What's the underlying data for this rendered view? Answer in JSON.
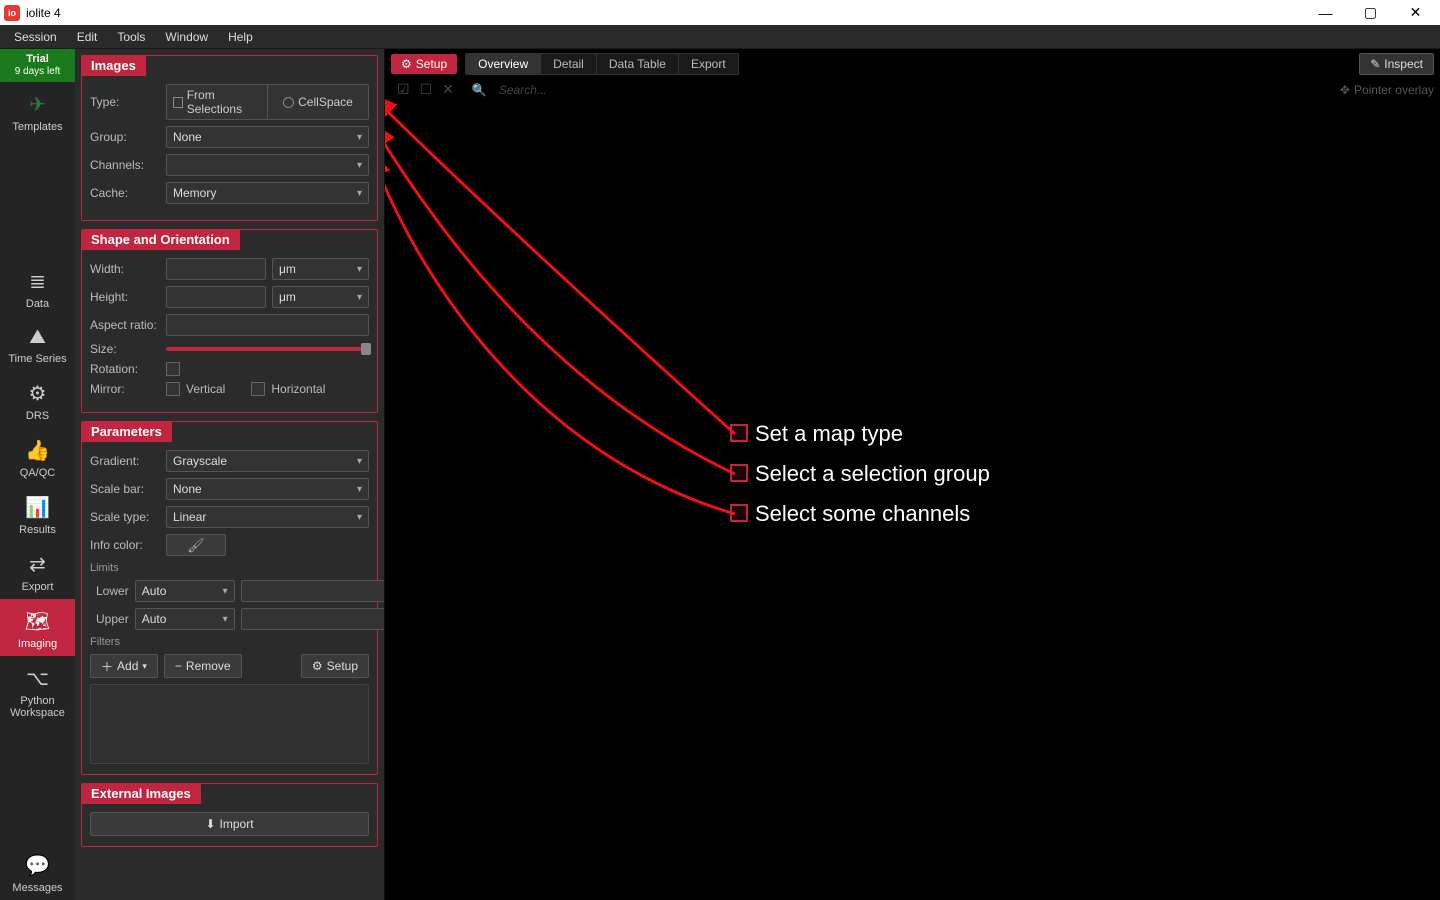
{
  "app": {
    "title": "iolite 4"
  },
  "window_controls": {
    "min": "—",
    "max": "▢",
    "close": "✕"
  },
  "menubar": [
    "Session",
    "Edit",
    "Tools",
    "Window",
    "Help"
  ],
  "trial": {
    "line1": "Trial",
    "line2": "9 days left"
  },
  "sidebar": [
    {
      "label": "Templates",
      "icon": "✈"
    },
    {
      "label": "Data",
      "icon": "≣"
    },
    {
      "label": "Time Series",
      "icon": "⛰"
    },
    {
      "label": "DRS",
      "icon": "⚙"
    },
    {
      "label": "QA/QC",
      "icon": "👍"
    },
    {
      "label": "Results",
      "icon": "📊"
    },
    {
      "label": "Export",
      "icon": "⇄"
    },
    {
      "label": "Imaging",
      "icon": "🗺"
    },
    {
      "label": "Python Workspace",
      "icon": "⌥"
    }
  ],
  "sidebar_bottom": {
    "label": "Messages",
    "icon": "💬"
  },
  "panel": {
    "images": {
      "header": "Images",
      "type_label": "Type:",
      "type_opts": [
        "From Selections",
        "CellSpace"
      ],
      "group_label": "Group:",
      "group_value": "None",
      "channels_label": "Channels:",
      "channels_value": "",
      "cache_label": "Cache:",
      "cache_value": "Memory"
    },
    "shape": {
      "header": "Shape and Orientation",
      "width_label": "Width:",
      "width_unit": "μm",
      "height_label": "Height:",
      "height_unit": "μm",
      "aspect_label": "Aspect ratio:",
      "size_label": "Size:",
      "rotation_label": "Rotation:",
      "mirror_label": "Mirror:",
      "mirror_v": "Vertical",
      "mirror_h": "Horizontal"
    },
    "params": {
      "header": "Parameters",
      "gradient_label": "Gradient:",
      "gradient_value": "Grayscale",
      "scalebar_label": "Scale bar:",
      "scalebar_value": "None",
      "scaletype_label": "Scale type:",
      "scaletype_value": "Linear",
      "infocolor_label": "Info color:",
      "limits_label": "Limits",
      "lower_label": "Lower",
      "lower_value": "Auto",
      "upper_label": "Upper",
      "upper_value": "Auto",
      "filters_label": "Filters",
      "add_btn": "Add",
      "remove_btn": "Remove",
      "setup_btn": "Setup"
    },
    "external": {
      "header": "External Images",
      "import_btn": "Import"
    }
  },
  "canvas": {
    "setup": "Setup",
    "tabs": [
      "Overview",
      "Detail",
      "Data Table",
      "Export"
    ],
    "inspect": "Inspect",
    "search_placeholder": "Search...",
    "pointer_overlay": "Pointer overlay"
  },
  "annotations": [
    "Set a map type",
    "Select a selection group",
    "Select some channels"
  ]
}
